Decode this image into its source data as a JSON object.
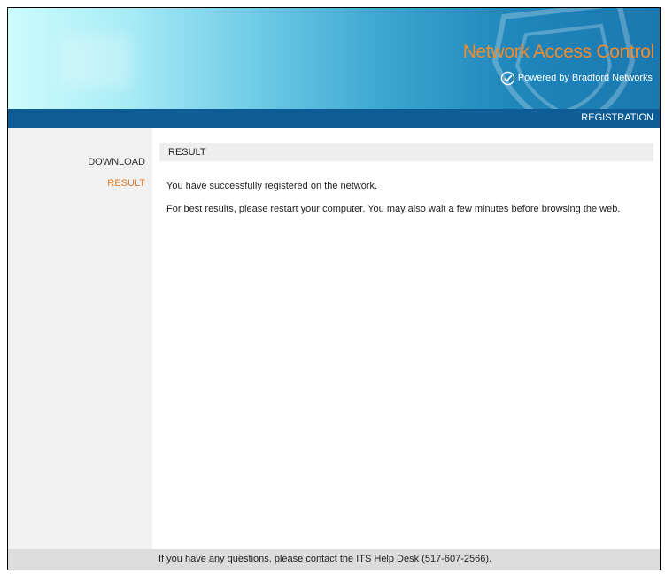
{
  "header": {
    "product_title": "Network Access Control",
    "powered_by": "Powered by Bradford Networks",
    "icons": {
      "check": "check-circle-icon",
      "watermark": "shield-icon"
    },
    "colors": {
      "title": "#f28b2d",
      "navbar": "#0e5c95"
    }
  },
  "nav": {
    "registration_label": "REGISTRATION"
  },
  "sidebar": {
    "items": [
      {
        "label": "DOWNLOAD",
        "active": false
      },
      {
        "label": "RESULT",
        "active": true
      }
    ],
    "active_color": "#e07820"
  },
  "main": {
    "section_title": "RESULT",
    "messages": [
      "You have successfully registered on the network.",
      "For best results, please restart your computer. You may also wait a few minutes before browsing the web."
    ]
  },
  "footer": {
    "text": "If you have any questions, please contact the ITS Help Desk (517-607-2566)."
  }
}
